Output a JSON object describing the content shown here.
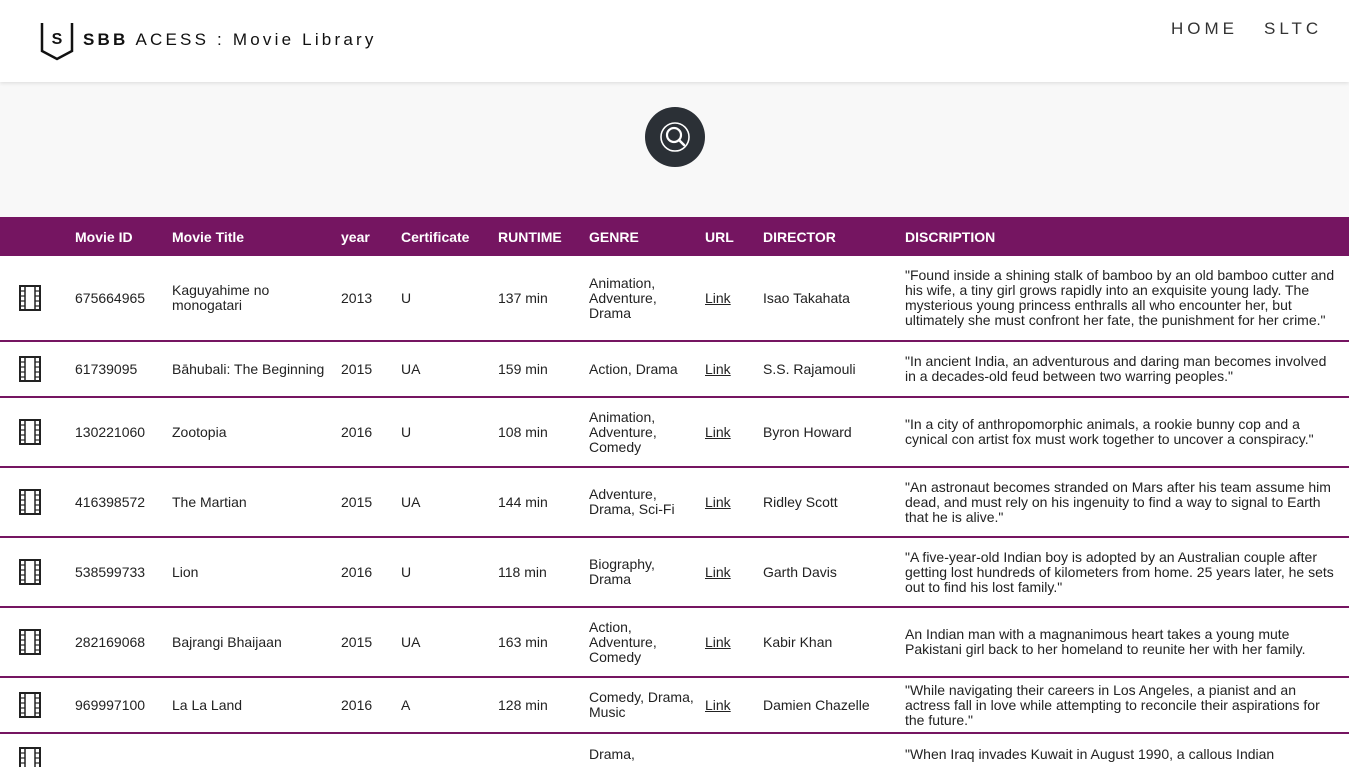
{
  "header": {
    "brand_bold": "SBB",
    "brand_rest": "ACESS : Movie Library",
    "logo_letter": "S",
    "nav": [
      "HOME",
      "SLTC"
    ]
  },
  "search": {
    "icon": "search-icon"
  },
  "table": {
    "columns": [
      "Movie ID",
      "Movie Title",
      "year",
      "Certificate",
      "RUNTIME",
      "GENRE",
      "URL",
      "DIRECTOR",
      "DISCRIPTION"
    ],
    "rows": [
      {
        "id": "675664965",
        "title": "Kaguyahime no monogatari",
        "year": "2013",
        "cert": "U",
        "runtime": "137 min",
        "genre": "Animation, Adventure, Drama",
        "url": "Link",
        "director": "Isao Takahata",
        "description": "\"Found inside a shining stalk of bamboo by an old bamboo cutter and his wife, a tiny girl grows rapidly into an exquisite young lady. The mysterious young princess enthralls all who encounter her, but ultimately she must confront her fate, the punishment for her crime.\""
      },
      {
        "id": "61739095",
        "title": "Bāhubali: The Beginning",
        "year": "2015",
        "cert": "UA",
        "runtime": "159 min",
        "genre": "Action, Drama",
        "url": "Link",
        "director": "S.S. Rajamouli",
        "description": "\"In ancient India, an adventurous and daring man becomes involved in a decades-old feud between two warring peoples.\""
      },
      {
        "id": "130221060",
        "title": "Zootopia",
        "year": "2016",
        "cert": "U",
        "runtime": "108 min",
        "genre": "Animation, Adventure, Comedy",
        "url": "Link",
        "director": "Byron Howard",
        "description": "\"In a city of anthropomorphic animals, a rookie bunny cop and a cynical con artist fox must work together to uncover a conspiracy.\""
      },
      {
        "id": "416398572",
        "title": "The Martian",
        "year": "2015",
        "cert": "UA",
        "runtime": "144 min",
        "genre": "Adventure, Drama, Sci-Fi",
        "url": "Link",
        "director": "Ridley Scott",
        "description": "\"An astronaut becomes stranded on Mars after his team assume him dead, and must rely on his ingenuity to find a way to signal to Earth that he is alive.\""
      },
      {
        "id": "538599733",
        "title": "Lion",
        "year": "2016",
        "cert": "U",
        "runtime": "118 min",
        "genre": "Biography, Drama",
        "url": "Link",
        "director": "Garth Davis",
        "description": "\"A five-year-old Indian boy is adopted by an Australian couple after getting lost hundreds of kilometers from home. 25 years later, he sets out to find his lost family.\""
      },
      {
        "id": "282169068",
        "title": "Bajrangi Bhaijaan",
        "year": "2015",
        "cert": "UA",
        "runtime": "163 min",
        "genre": "Action, Adventure, Comedy",
        "url": "Link",
        "director": "Kabir Khan",
        "description": "An Indian man with a magnanimous heart takes a young mute Pakistani girl back to her homeland to reunite her with her family."
      },
      {
        "id": "969997100",
        "title": "La La Land",
        "year": "2016",
        "cert": "A",
        "runtime": "128 min",
        "genre": "Comedy, Drama, Music",
        "url": "Link",
        "director": "Damien Chazelle",
        "description": "\"While navigating their careers in Los Angeles, a pianist and an actress fall in love while attempting to reconcile their aspirations for the future.\""
      },
      {
        "id": "",
        "title": "",
        "year": "",
        "cert": "",
        "runtime": "",
        "genre": "Drama,",
        "url": "",
        "director": "",
        "description": "\"When Iraq invades Kuwait in August 1990, a callous Indian"
      }
    ]
  },
  "colors": {
    "accent": "#751561",
    "search_bg": "#2b3036"
  }
}
